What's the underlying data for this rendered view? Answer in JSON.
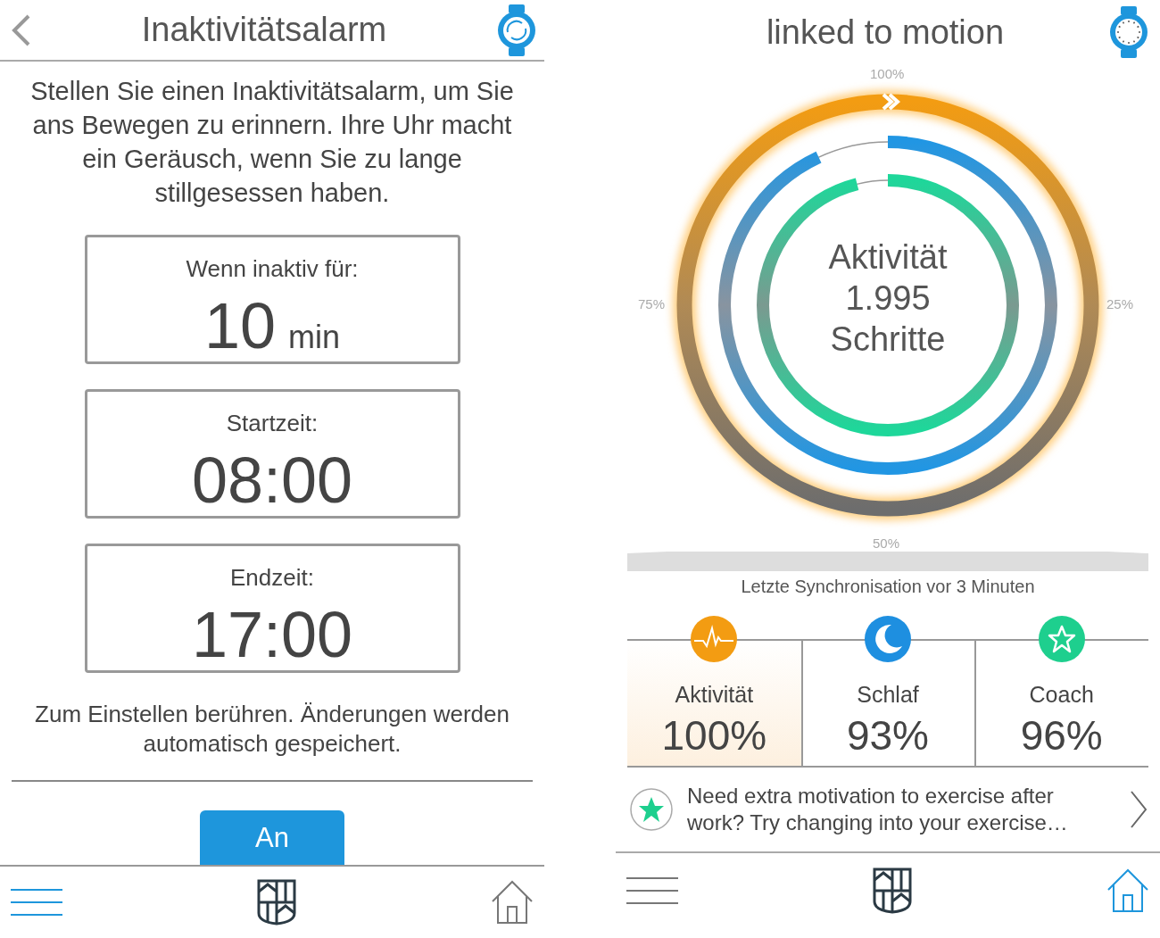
{
  "left": {
    "header": {
      "title": "Inaktivitätsalarm"
    },
    "description": "Stellen Sie einen Inaktivitätsalarm, um Sie ans Bewegen zu erinnern. Ihre Uhr macht ein Geräusch, wenn Sie zu lange stillgesessen haben.",
    "settings": [
      {
        "label": "Wenn inaktiv für:",
        "value": "10",
        "unit": "min"
      },
      {
        "label": "Startzeit:",
        "value": "08:00"
      },
      {
        "label": "Endzeit:",
        "value": "17:00"
      }
    ],
    "hint": "Zum Einstellen berühren. Änderungen werden automatisch gespeichert.",
    "toggle": {
      "label": "An",
      "on": true
    },
    "nav": [
      {
        "kind": "menu",
        "selected": true
      },
      {
        "kind": "crest"
      },
      {
        "kind": "home",
        "selected": false
      }
    ]
  },
  "right": {
    "header": {
      "title": "linked to motion"
    },
    "rings": {
      "ticks": [
        "100%",
        "25%",
        "50%",
        "75%"
      ],
      "center": [
        "Aktivität",
        "1.995",
        "Schritte"
      ],
      "series": [
        {
          "level": 1.0
        },
        {
          "level": 0.93
        },
        {
          "level": 0.96
        }
      ]
    },
    "sync": "Letzte Synchronisation vor 3 Minuten",
    "tiles": [
      {
        "kind": "activity",
        "label": "Aktivität",
        "value": "100%",
        "selected": true,
        "color": "#f39c12"
      },
      {
        "kind": "sleep",
        "label": "Schlaf",
        "value": "93%",
        "selected": false,
        "color": "#1e8fe0"
      },
      {
        "kind": "coach",
        "label": "Coach",
        "value": "96%",
        "selected": false,
        "color": "#1ecf8e"
      }
    ],
    "tip": "Need extra motivation to exercise after work? Try changing into your exercise…",
    "nav": [
      {
        "kind": "menu",
        "selected": false
      },
      {
        "kind": "crest"
      },
      {
        "kind": "home",
        "selected": true
      }
    ]
  }
}
